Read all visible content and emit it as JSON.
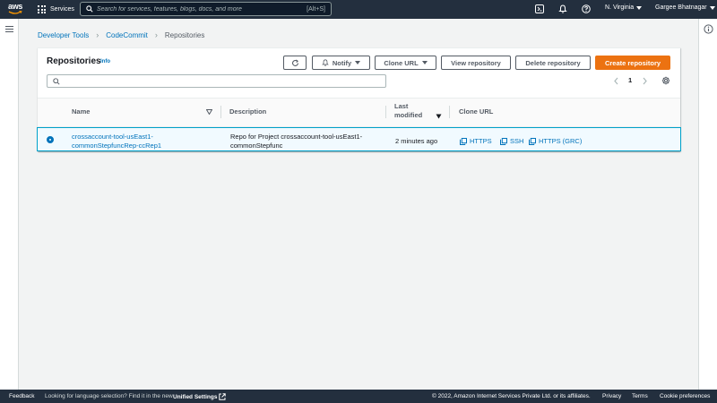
{
  "topnav": {
    "logo_text": "aws",
    "services_label": "Services",
    "search_placeholder": "Search for services, features, blogs, docs, and more",
    "search_shortcut": "[Alt+S]",
    "region": "N. Virginia",
    "user": "Gargee Bhatnagar"
  },
  "breadcrumb": {
    "items": [
      "Developer Tools",
      "CodeCommit"
    ],
    "current": "Repositories"
  },
  "repositories": {
    "title": "Repositories",
    "info_label": "Info",
    "buttons": {
      "notify": "Notify",
      "clone_url": "Clone URL",
      "view": "View repository",
      "delete": "Delete repository",
      "create": "Create repository"
    },
    "page_number": "1",
    "columns": {
      "name": "Name",
      "description": "Description",
      "last_modified": "Last modified",
      "clone_url": "Clone URL"
    },
    "rows": [
      {
        "name_line1": "crossaccount-tool-usEast1-",
        "name_line2": "commonStepfuncRep-ccRep1",
        "desc_line1": "Repo for Project crossaccount-tool-usEast1-",
        "desc_line2": "commonStepfunc",
        "last_modified": "2 minutes ago",
        "clone_https": "HTTPS",
        "clone_ssh": "SSH",
        "clone_grc": "HTTPS (GRC)",
        "selected": true
      }
    ]
  },
  "footer": {
    "feedback": "Feedback",
    "language_prompt": "Looking for language selection? Find it in the new",
    "unified_settings": "Unified Settings",
    "copyright": "© 2022, Amazon Internet Services Private Ltd. or its affiliates.",
    "privacy": "Privacy",
    "terms": "Terms",
    "cookie": "Cookie preferences"
  },
  "colors": {
    "nav_bg": "#232f3e",
    "accent_orange": "#ec7211",
    "link_blue": "#0073bb",
    "selected_row": "#f1faff"
  }
}
